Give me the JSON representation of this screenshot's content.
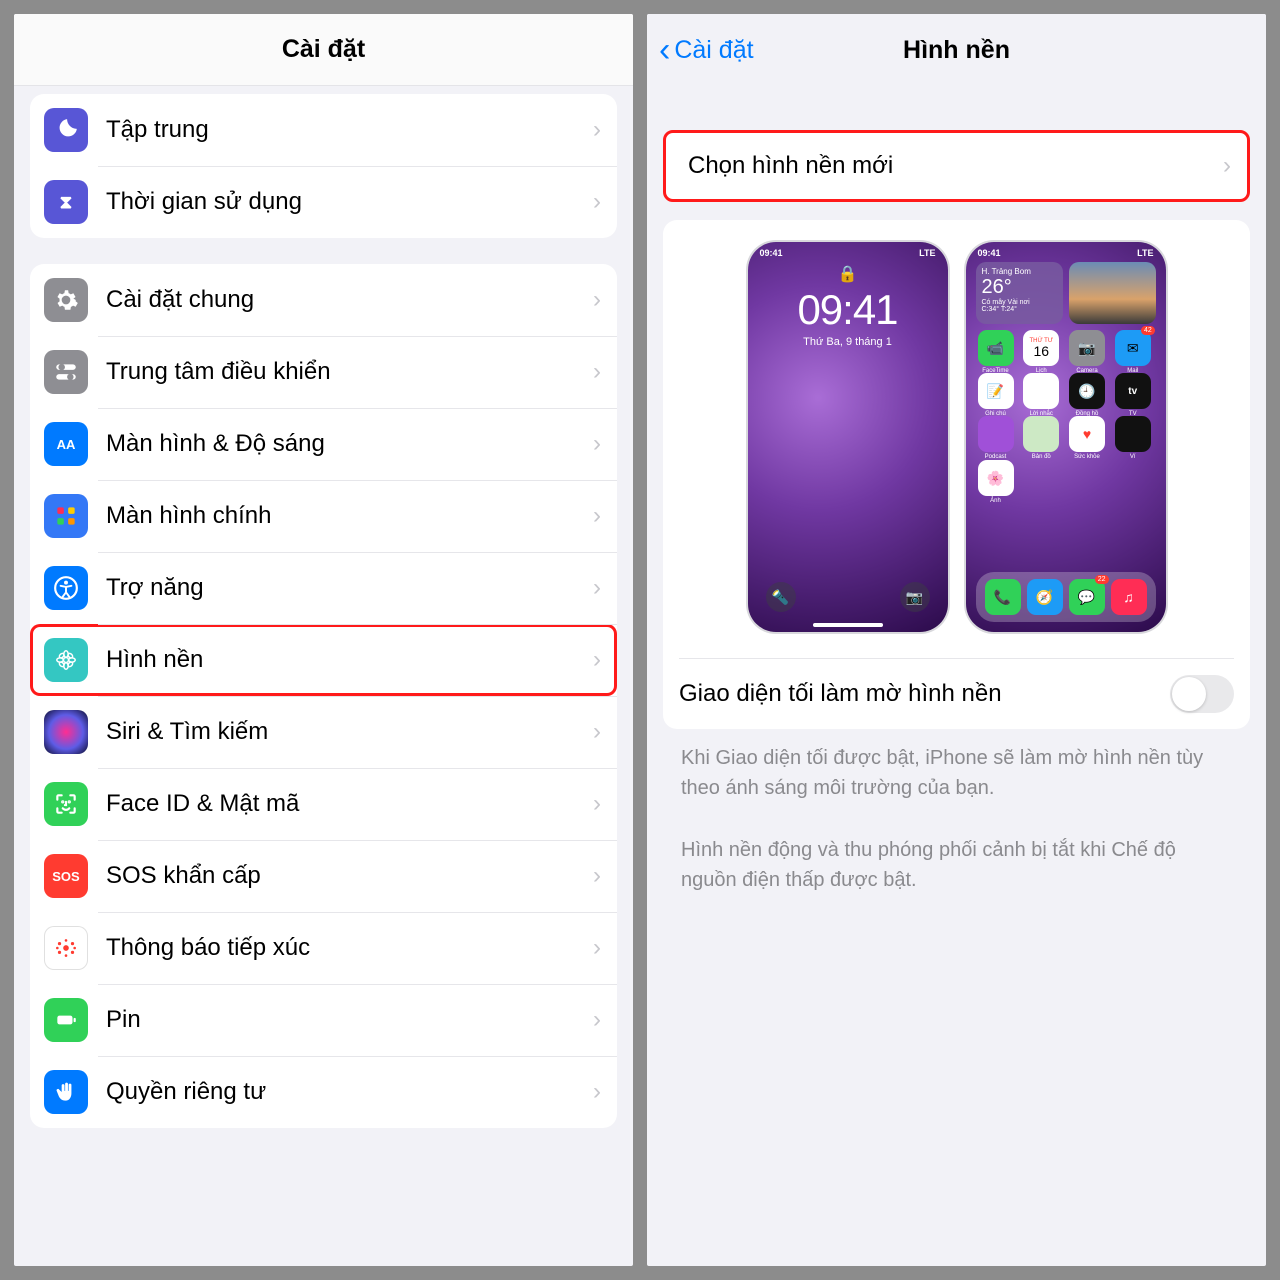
{
  "left": {
    "title": "Cài đặt",
    "group1": [
      {
        "icon": "moon",
        "label": "Tập trung"
      },
      {
        "icon": "time",
        "label": "Thời gian sử dụng"
      }
    ],
    "group2": [
      {
        "icon": "gear",
        "label": "Cài đặt chung"
      },
      {
        "icon": "cc",
        "label": "Trung tâm điều khiển"
      },
      {
        "icon": "aa",
        "label": "Màn hình & Độ sáng"
      },
      {
        "icon": "home",
        "label": "Màn hình chính"
      },
      {
        "icon": "acc",
        "label": "Trợ năng"
      },
      {
        "icon": "wall",
        "label": "Hình nền",
        "highlight": true
      },
      {
        "icon": "siri",
        "label": "Siri & Tìm kiếm"
      },
      {
        "icon": "face",
        "label": "Face ID & Mật mã"
      },
      {
        "icon": "sos",
        "label": "SOS khẩn cấp"
      },
      {
        "icon": "expo",
        "label": "Thông báo tiếp xúc"
      },
      {
        "icon": "batt",
        "label": "Pin"
      },
      {
        "icon": "priv",
        "label": "Quyền riêng tư"
      }
    ]
  },
  "right": {
    "back": "Cài đặt",
    "title": "Hình nền",
    "choose": "Chọn hình nền mới",
    "lock": {
      "time": "09:41",
      "date": "Thứ Ba, 9 tháng 1",
      "status_left": "09:41",
      "status_right": "LTE"
    },
    "home": {
      "status_left": "09:41",
      "status_right": "LTE",
      "weather": {
        "city": "H. Trảng Bom",
        "temp": "26°",
        "cond": "Có mây Vài nơi",
        "hi": "C:34° T:24°"
      },
      "apps": [
        {
          "name": "FaceTime",
          "bg": "#30d158",
          "glyph": "📹"
        },
        {
          "name": "Lịch",
          "bg": "#fff",
          "glyph": "16",
          "sub": "THỨ TƯ"
        },
        {
          "name": "Camera",
          "bg": "#8e8e93",
          "glyph": "📷"
        },
        {
          "name": "Mail",
          "bg": "#1d9bf6",
          "glyph": "✉︎",
          "badge": "42"
        },
        {
          "name": "Ghi chú",
          "bg": "#fff",
          "glyph": "📝"
        },
        {
          "name": "Lời nhắc",
          "bg": "#fff",
          "glyph": ""
        },
        {
          "name": "Đồng hồ",
          "bg": "#111",
          "glyph": "🕘"
        },
        {
          "name": "TV",
          "bg": "#111",
          "glyph": "tv"
        },
        {
          "name": "Podcast",
          "bg": "#a050d8",
          "glyph": ""
        },
        {
          "name": "Bản đồ",
          "bg": "#cde9c5",
          "glyph": ""
        },
        {
          "name": "Sức khỏe",
          "bg": "#fff",
          "glyph": "♥"
        },
        {
          "name": "Ví",
          "bg": "#111",
          "glyph": ""
        }
      ],
      "photos_app": "Ảnh",
      "dock": [
        {
          "bg": "#30d158",
          "glyph": "📞"
        },
        {
          "bg": "#1d9bf6",
          "glyph": "🧭"
        },
        {
          "bg": "#30d158",
          "glyph": "💬",
          "badge": "22"
        },
        {
          "bg": "#ff2d55",
          "glyph": "♫"
        }
      ]
    },
    "toggle_label": "Giao diện tối làm mờ hình nền",
    "note1": "Khi Giao diện tối được bật, iPhone sẽ làm mờ hình nền tùy theo ánh sáng môi trường của bạn.",
    "note2": "Hình nền động và thu phóng phối cảnh bị tắt khi Chế độ nguồn điện thấp được bật."
  }
}
